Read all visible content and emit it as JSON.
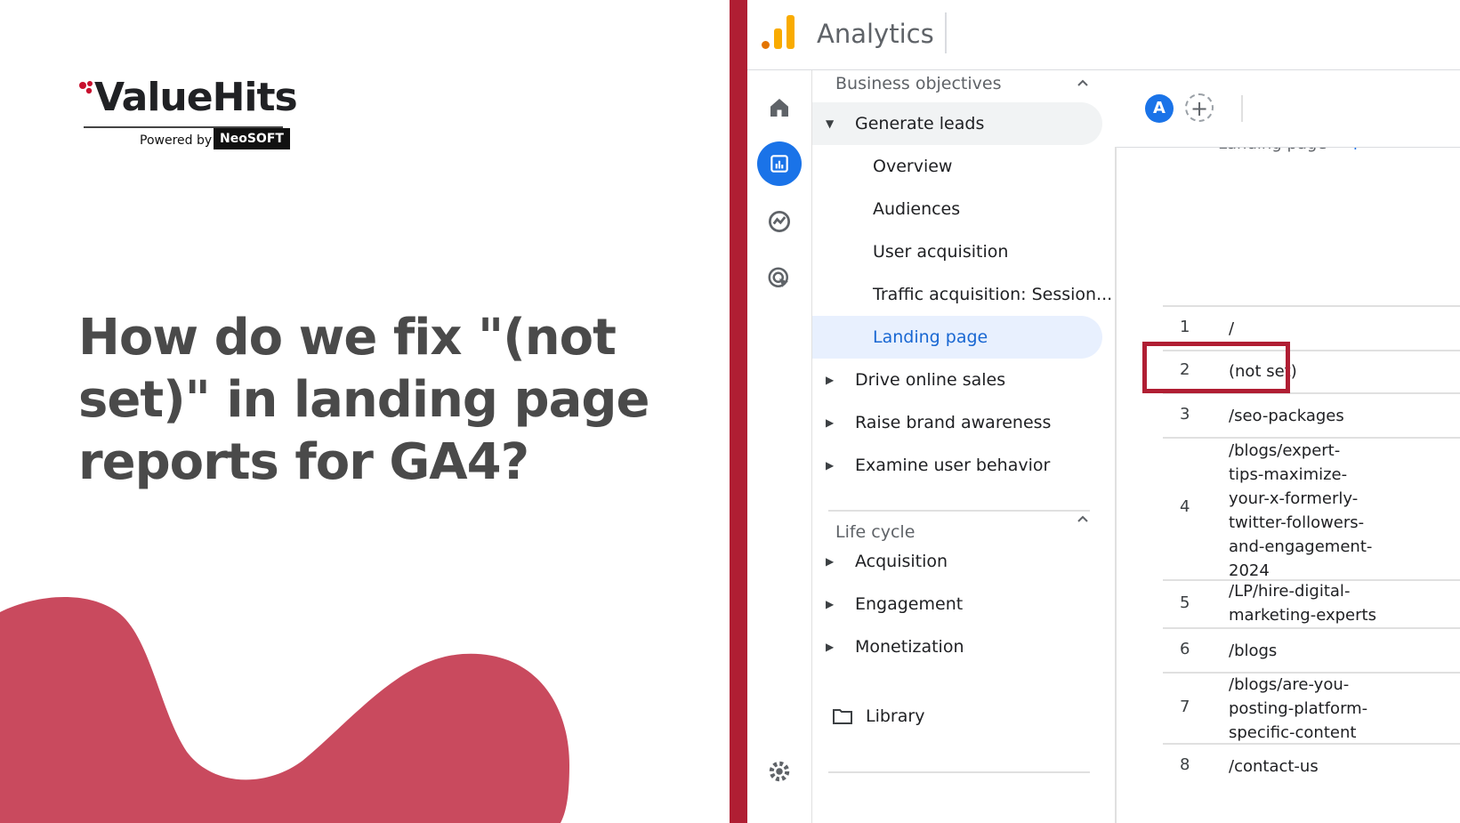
{
  "brand": {
    "logo_text": "ValueHits",
    "powered_by": "Powered by",
    "partner": "NeoSOFT",
    "colors": {
      "brand_red": "#c8102e",
      "accent_bar": "#b01e33",
      "blob": "#c94a5e",
      "headline": "#4a4a4a"
    }
  },
  "headline": "How do we fix \"(not set)\" in landing page reports for GA4?",
  "analytics": {
    "title": "Analytics",
    "rail_icons": [
      "home-icon",
      "reports-icon",
      "explore-icon",
      "advertising-icon",
      "settings-icon"
    ],
    "nav": {
      "section1": "Business objectives",
      "generate_leads": "Generate leads",
      "overview": "Overview",
      "audiences": "Audiences",
      "user_acquisition": "User acquisition",
      "traffic_acquisition": "Traffic acquisition: Session...",
      "landing_page": "Landing page",
      "drive_online_sales": "Drive online sales",
      "raise_brand_awareness": "Raise brand awareness",
      "examine_user_behavior": "Examine user behavior",
      "section2": "Life cycle",
      "acquisition": "Acquisition",
      "engagement": "Engagement",
      "monetization": "Monetization",
      "library": "Library"
    },
    "toolbar": {
      "avatar_letter": "A",
      "add_label": "+"
    },
    "table": {
      "column_header": "Landing page",
      "add_column": "+",
      "rows": [
        {
          "num": "1",
          "page": "/"
        },
        {
          "num": "2",
          "page": "(not set)"
        },
        {
          "num": "3",
          "page": "/seo-packages"
        },
        {
          "num": "4",
          "page": "/blogs/expert-\ntips-maximize-\nyour-x-formerly-\ntwitter-followers-\nand-engagement-\n2024"
        },
        {
          "num": "5",
          "page": "/LP/hire-digital-\nmarketing-experts"
        },
        {
          "num": "6",
          "page": "/blogs"
        },
        {
          "num": "7",
          "page": "/blogs/are-you-\nposting-platform-\nspecific-content"
        },
        {
          "num": "8",
          "page": "/contact-us"
        }
      ]
    }
  }
}
